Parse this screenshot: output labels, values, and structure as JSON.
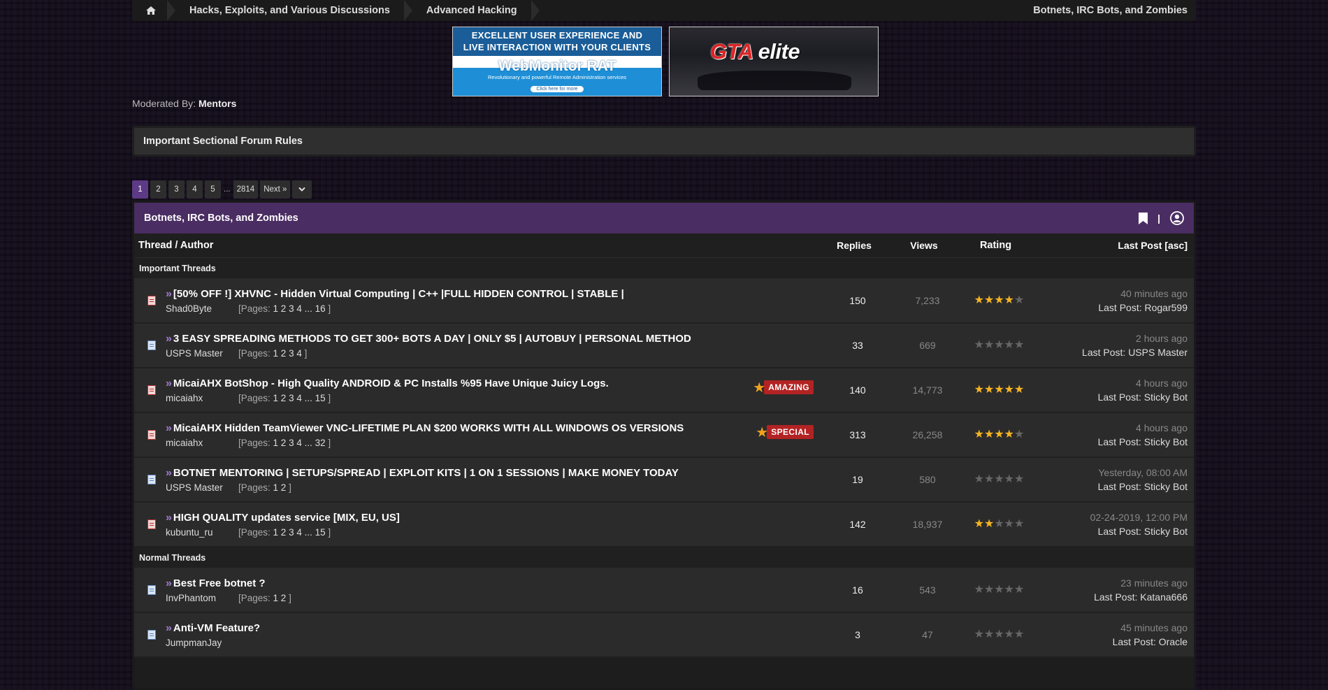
{
  "breadcrumb": {
    "items": [
      "Hacks, Exploits, and Various Discussions",
      "Advanced Hacking"
    ],
    "current": "Botnets, IRC Bots, and Zombies"
  },
  "banners": {
    "a": {
      "line1": "EXCELLENT USER EXPERIENCE AND",
      "line2": "LIVE INTERACTION WITH YOUR CLIENTS",
      "name": "WebMonitor RAT",
      "tag": "Revolutionary and powerful Remote Administration services",
      "cta": "Click here for more"
    },
    "b": {
      "gta": "GTA",
      "elite": "elite"
    }
  },
  "moderated": {
    "label": "Moderated By:",
    "value": "Mentors"
  },
  "rules": {
    "label": "Important Sectional Forum Rules"
  },
  "pager": {
    "pages": [
      "1",
      "2",
      "3",
      "4",
      "5"
    ],
    "dots": "...",
    "last": "2814",
    "next": "Next »"
  },
  "forum": {
    "title": "Botnets, IRC Bots, and Zombies"
  },
  "columns": {
    "thread": "Thread / Author",
    "replies": "Replies",
    "views": "Views",
    "rating": "Rating",
    "last": "Last Post",
    "sort": "[asc]"
  },
  "sections": {
    "important": "Important Threads",
    "normal": "Normal Threads"
  },
  "threads": [
    {
      "title": "[50% OFF !] XHVNC - Hidden Virtual Computing | C++ |FULL HIDDEN CONTROL | STABLE |",
      "author": "Shad0Byte",
      "pages": "1 2 3 4 ... 16",
      "replies": "150",
      "views": "7,233",
      "rating": 4,
      "time": "40 minutes ago",
      "lastby": "Rogar599",
      "icon": "hot",
      "badge": ""
    },
    {
      "title": "3 EASY SPREADING METHODS TO GET 300+ BOTS A DAY | ONLY $5 | AUTOBUY | PERSONAL METHOD",
      "author": "USPS Master",
      "pages": "1 2 3 4",
      "replies": "33",
      "views": "669",
      "rating": 0,
      "time": "2 hours ago",
      "lastby": "USPS Master",
      "icon": "norm",
      "badge": ""
    },
    {
      "title": "MicaiAHX BotShop - High Quality ANDROID & PC Installs %95 Have Unique Juicy Logs.",
      "author": "micaiahx",
      "pages": "1 2 3 4 ... 15",
      "replies": "140",
      "views": "14,773",
      "rating": 5,
      "time": "4 hours ago",
      "lastby": "Sticky Bot",
      "icon": "hot",
      "badge": "AMAZING"
    },
    {
      "title": "MicaiAHX Hidden TeamViewer VNC-LIFETIME PLAN $200 WORKS WITH ALL WINDOWS OS VERSIONS",
      "author": "micaiahx",
      "pages": "1 2 3 4 ... 32",
      "replies": "313",
      "views": "26,258",
      "rating": 4,
      "time": "4 hours ago",
      "lastby": "Sticky Bot",
      "icon": "hot",
      "badge": "SPECIAL"
    },
    {
      "title": "BOTNET MENTORING | SETUPS/SPREAD | EXPLOIT KITS | 1 ON 1 SESSIONS | MAKE MONEY TODAY",
      "author": "USPS Master",
      "pages": "1 2",
      "replies": "19",
      "views": "580",
      "rating": 0,
      "time": "Yesterday, 08:00 AM",
      "lastby": "Sticky Bot",
      "icon": "norm",
      "badge": ""
    },
    {
      "title": "HIGH QUALITY updates service [MIX, EU, US]",
      "author": "kubuntu_ru",
      "pages": "1 2 3 4 ... 15",
      "replies": "142",
      "views": "18,937",
      "rating": 2,
      "time": "02-24-2019, 12:00 PM",
      "lastby": "Sticky Bot",
      "icon": "hot",
      "badge": ""
    }
  ],
  "normal_threads": [
    {
      "title": "Best Free botnet ?",
      "author": "InvPhantom",
      "pages": "1 2",
      "replies": "16",
      "views": "543",
      "rating": 0,
      "time": "23 minutes ago",
      "lastby": "Katana666",
      "icon": "norm"
    },
    {
      "title": "Anti-VM Feature?",
      "author": "JumpmanJay",
      "pages": "",
      "replies": "3",
      "views": "47",
      "rating": 0,
      "time": "45 minutes ago",
      "lastby": "Oracle",
      "icon": "norm"
    }
  ],
  "labels": {
    "pages_prefix": "[Pages:",
    "pages_suffix": "]",
    "last_post_prefix": "Last Post:"
  }
}
